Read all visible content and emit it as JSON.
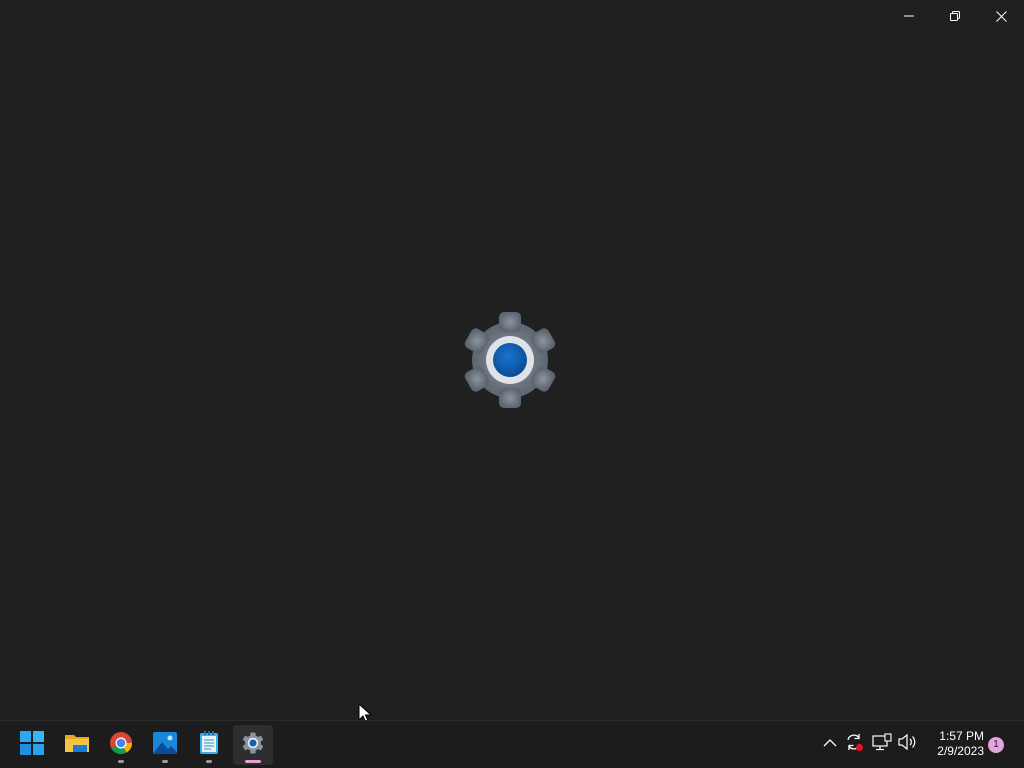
{
  "window": {
    "app": "Settings",
    "splash_icon": "settings-gear-icon",
    "controls": {
      "minimize_icon": "minimize-icon",
      "restore_icon": "restore-icon",
      "close_icon": "close-icon"
    }
  },
  "taskbar": {
    "start_icon": "windows-start-icon",
    "pinned_apps": [
      {
        "icon": "file-explorer-icon",
        "running": true,
        "active": false
      },
      {
        "icon": "chrome-icon",
        "running": true,
        "active": false
      },
      {
        "icon": "photos-icon",
        "running": true,
        "active": false
      },
      {
        "icon": "notepad-icon",
        "running": true,
        "active": false
      },
      {
        "icon": "settings-icon",
        "running": true,
        "active": true
      }
    ],
    "tray": {
      "icons": [
        "chevron-up-icon",
        "sync-icon",
        "network-icon",
        "volume-icon"
      ],
      "time": "1:57 PM",
      "date": "2/9/2023",
      "notification_count": "1"
    }
  },
  "colors": {
    "background": "#202020",
    "taskbar": "#1c1c1c",
    "accent": "#0f5fb6",
    "active_indicator": "#e6a0d6"
  }
}
